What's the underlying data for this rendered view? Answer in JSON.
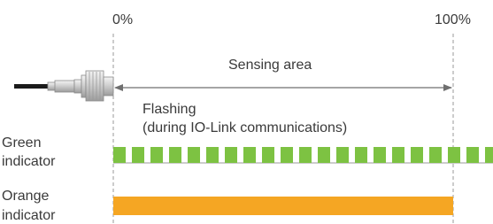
{
  "scale": {
    "start_label": "0%",
    "end_label": "100%"
  },
  "sensing_area_label": "Sensing area",
  "flashing_note": {
    "line1": "Flashing",
    "line2": "(during IO-Link communications)"
  },
  "indicators": [
    {
      "label_line1": "Green",
      "label_line2": "indicator",
      "pattern": "flashing",
      "color": "#7dc242"
    },
    {
      "label_line1": "Orange",
      "label_line2": "indicator",
      "pattern": "steady",
      "color": "#f5a623"
    }
  ],
  "colors": {
    "text": "#3a3a3a",
    "guide": "#9a9a9a",
    "arrow": "#6f6f6f",
    "cable": "#1a1a1a"
  }
}
